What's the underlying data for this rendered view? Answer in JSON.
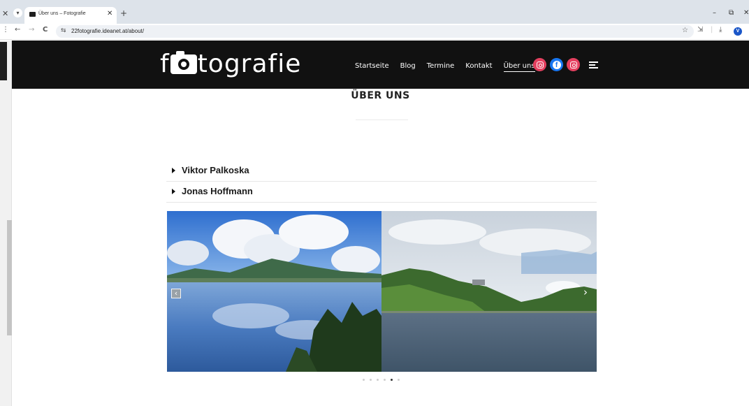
{
  "browser": {
    "tab_title": "Über uns – Fotografie",
    "url": "22fotografie.ideanet.at/about/",
    "profile_initial": "V",
    "controls": {
      "close_glyph": "✕",
      "newtab_glyph": "+",
      "tab_close_glyph": "✕",
      "minimize_glyph": "–",
      "restore_glyph": "⧉",
      "window_close_glyph": "✕",
      "menu_glyph": "⋮",
      "back_glyph": "←",
      "forward_glyph": "→",
      "reload_glyph": "C",
      "site_info_glyph": "⇆",
      "star_glyph": "☆",
      "extensions_glyph": "⇲",
      "divider_glyph": "|",
      "download_glyph": "⤓"
    }
  },
  "site": {
    "logo": {
      "before": "f",
      "after": "tografie"
    },
    "nav": [
      {
        "label": "Startseite",
        "active": false
      },
      {
        "label": "Blog",
        "active": false
      },
      {
        "label": "Termine",
        "active": false
      },
      {
        "label": "Kontakt",
        "active": false
      },
      {
        "label": "Über uns",
        "active": true
      }
    ],
    "social": [
      {
        "icon": "instagram-icon",
        "color": "#e4405f"
      },
      {
        "icon": "facebook-icon",
        "color": "#1877f2"
      },
      {
        "icon": "instagram-icon",
        "color": "#e4405f"
      }
    ],
    "facebook_glyph": "f"
  },
  "page": {
    "title": "ÜBER UNS",
    "accordion": [
      {
        "label": "Viktor Palkoska"
      },
      {
        "label": "Jonas Hoffmann"
      }
    ]
  },
  "slider": {
    "prev_glyph": "‹",
    "next_glyph": "›",
    "dot_count": 6,
    "active_dot": 4
  },
  "colors": {
    "header_bg": "#111111",
    "instagram": "#e4405f",
    "facebook": "#1877f2"
  }
}
